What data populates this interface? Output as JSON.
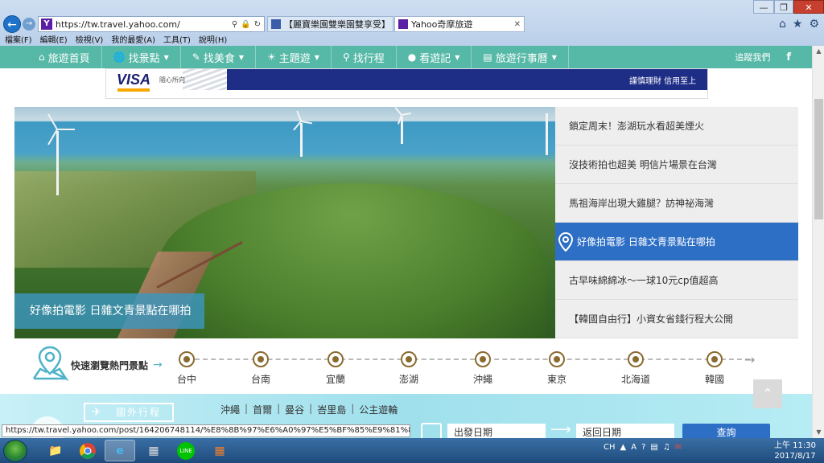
{
  "browser": {
    "url": "https://tw.travel.yahoo.com/",
    "tabs": [
      {
        "label": "【麗寶樂園雙樂園雙享受】台中..."
      },
      {
        "label": "Yahoo奇摩旅遊"
      }
    ],
    "menu": [
      "檔案(F)",
      "編輯(E)",
      "檢視(V)",
      "我的最愛(A)",
      "工具(T)",
      "說明(H)"
    ],
    "status_url": "https://tw.travel.yahoo.com/post/164206748114/%E8%8B%97%E6%A0%97%E5%BF%85%E9%81%8A%E6%99..."
  },
  "nav": {
    "home": "旅遊首頁",
    "items": [
      "找景點",
      "找美食",
      "主題遊",
      "找行程",
      "看遊記",
      "旅遊行事曆"
    ],
    "follow": "追蹤我們",
    "fb": "f"
  },
  "ad": {
    "brand": "VISA",
    "slogan": "隨心所向",
    "tagline": "謹慎理財 信用至上"
  },
  "hero": {
    "caption": "好像拍電影 日雜文青景點在哪拍"
  },
  "articles": [
    {
      "title": "鎖定周末！澎湖玩水看超美煙火",
      "active": false
    },
    {
      "title": "沒技術拍也超美 明信片場景在台灣",
      "active": false
    },
    {
      "title": "馬祖海岸出現大雞腿？訪神祕海灣",
      "active": false
    },
    {
      "title": "好像拍電影 日雜文青景點在哪拍",
      "active": true
    },
    {
      "title": "古早味綿綿冰～一球10元cp值超高",
      "active": false
    },
    {
      "title": "【韓國自由行】小資女省錢行程大公開",
      "active": false
    }
  ],
  "quick": {
    "label": "快速瀏覽熱門景點",
    "spots": [
      "台中",
      "台南",
      "宜蘭",
      "澎湖",
      "沖繩",
      "東京",
      "北海道",
      "韓國"
    ]
  },
  "overseas": {
    "label": "國外行程",
    "links": [
      "沖繩",
      "首爾",
      "曼谷",
      "峇里島",
      "公主遊輪"
    ],
    "depart_placeholder": "出發日期",
    "return_placeholder": "返回日期",
    "search": "查詢"
  },
  "taskbar": {
    "lang": "CH",
    "time": "上午 11:30",
    "date": "2017/8/17"
  },
  "colors": {
    "nav_bg": "#56b8a6",
    "active_bg": "#2e6fc6",
    "band_bg": "#9fe0ec"
  }
}
